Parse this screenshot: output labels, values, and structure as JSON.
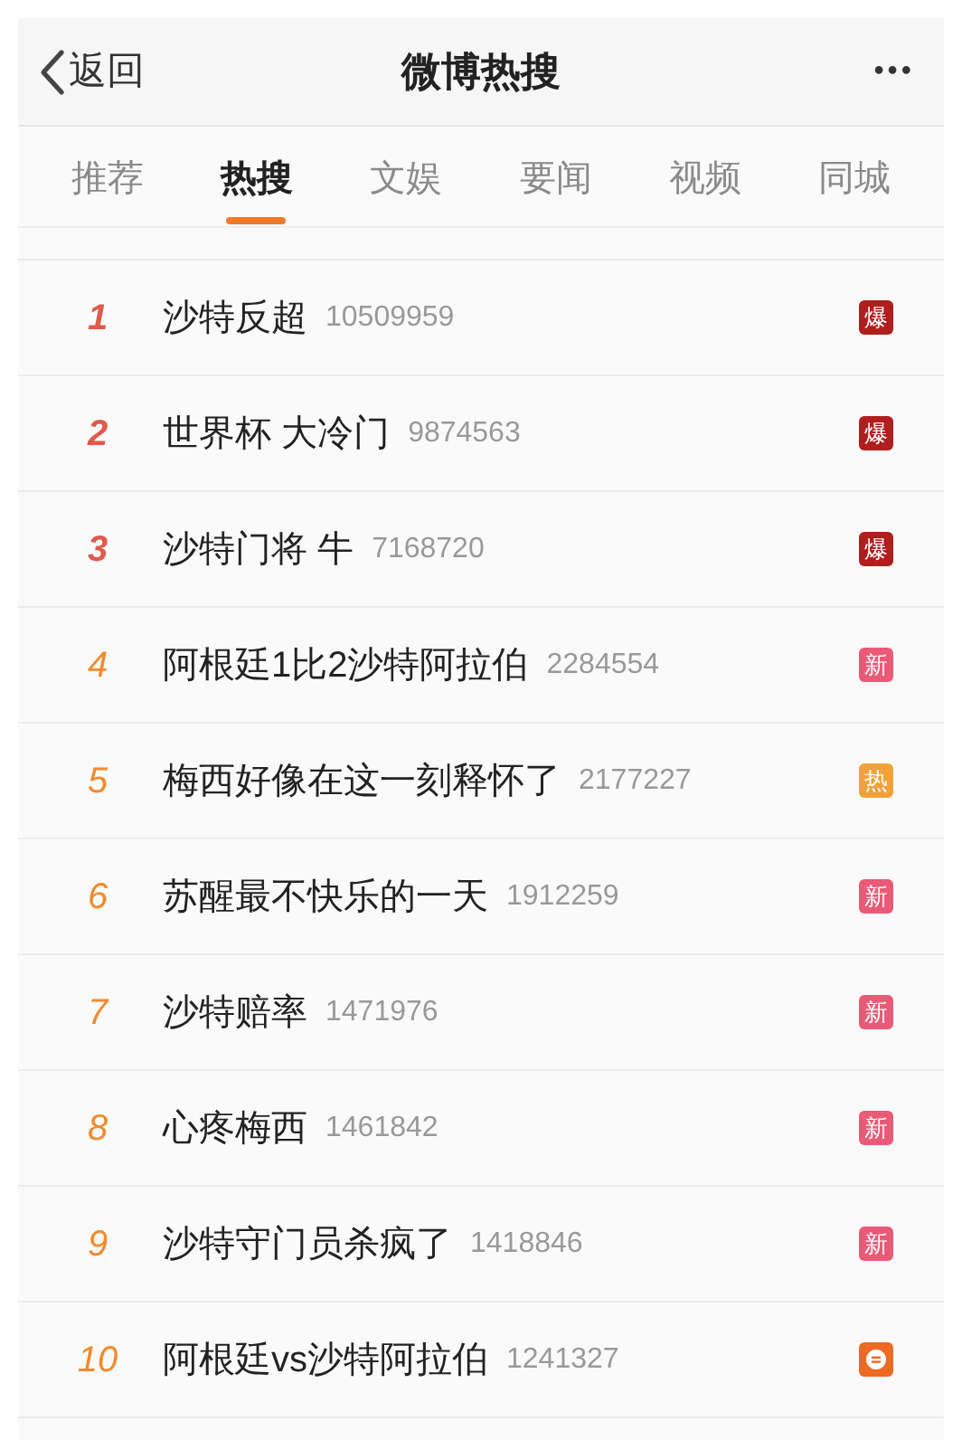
{
  "header": {
    "back": "返回",
    "title": "微博热搜",
    "more": "•••"
  },
  "tabs": [
    {
      "label": "推荐",
      "selected": false
    },
    {
      "label": "热搜",
      "selected": true
    },
    {
      "label": "文娱",
      "selected": false
    },
    {
      "label": "要闻",
      "selected": false
    },
    {
      "label": "视频",
      "selected": false
    },
    {
      "label": "同城",
      "selected": false
    }
  ],
  "items": [
    {
      "rank": "1",
      "top": true,
      "title": "沙特反超",
      "count": "10509959",
      "badge": {
        "kind": "boom",
        "label": "爆"
      }
    },
    {
      "rank": "2",
      "top": true,
      "title": "世界杯 大冷门",
      "count": "9874563",
      "badge": {
        "kind": "boom",
        "label": "爆"
      }
    },
    {
      "rank": "3",
      "top": true,
      "title": "沙特门将 牛",
      "count": "7168720",
      "badge": {
        "kind": "boom",
        "label": "爆"
      }
    },
    {
      "rank": "4",
      "top": false,
      "title": "阿根廷1比2沙特阿拉伯",
      "count": "2284554",
      "badge": {
        "kind": "new",
        "label": "新"
      }
    },
    {
      "rank": "5",
      "top": false,
      "title": "梅西好像在这一刻释怀了",
      "count": "2177227",
      "badge": {
        "kind": "hot",
        "label": "热"
      }
    },
    {
      "rank": "6",
      "top": false,
      "title": "苏醒最不快乐的一天",
      "count": "1912259",
      "badge": {
        "kind": "new",
        "label": "新"
      }
    },
    {
      "rank": "7",
      "top": false,
      "title": "沙特赔率",
      "count": "1471976",
      "badge": {
        "kind": "new",
        "label": "新"
      }
    },
    {
      "rank": "8",
      "top": false,
      "title": "心疼梅西",
      "count": "1461842",
      "badge": {
        "kind": "new",
        "label": "新"
      }
    },
    {
      "rank": "9",
      "top": false,
      "title": "沙特守门员杀疯了",
      "count": "1418846",
      "badge": {
        "kind": "new",
        "label": "新"
      }
    },
    {
      "rank": "10",
      "top": false,
      "title": "阿根廷vs沙特阿拉伯",
      "count": "1241327",
      "badge": {
        "kind": "chat"
      }
    }
  ]
}
